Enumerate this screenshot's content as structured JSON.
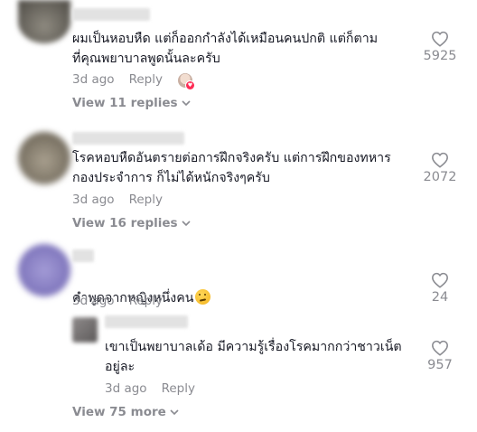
{
  "comments": [
    {
      "text": "ผมเป็นหอบหืด แต่ก็ออกกำลังได้เหมือนคนปกติ แต่ก็ตาม\nที่คุณพยาบาลพูดนั้นละครับ",
      "time": "3d ago",
      "reply_label": "Reply",
      "likes": "5925",
      "creator_liked": true,
      "view_replies": "View 11 replies"
    },
    {
      "text": "โรคหอบหืดอันตรายต่อการฝึกจริงครับ แต่การฝึกของทหาร\nกองประจำการ ก็ไม่ได้หนักจริงๆครับ",
      "time": "3d ago",
      "reply_label": "Reply",
      "likes": "2072",
      "view_replies": "View 16 replies"
    },
    {
      "text": "คำพูดจากหญิงหนึ่งคน",
      "emoji": "thinking-face",
      "time": "3d ago",
      "reply_label": "Reply",
      "likes": "24",
      "reply": {
        "text": "เขาเป็นพยาบาลเด้อ มีความรู้เรื่องโรคมากกว่าชาวเน็ต\nอยู่ละ",
        "time": "3d ago",
        "reply_label": "Reply",
        "likes": "957"
      },
      "view_more": "View 75 more"
    }
  ],
  "colors": {
    "text": "#161823",
    "secondary": "#8a8b91",
    "heart_badge": "#fe2c55"
  }
}
